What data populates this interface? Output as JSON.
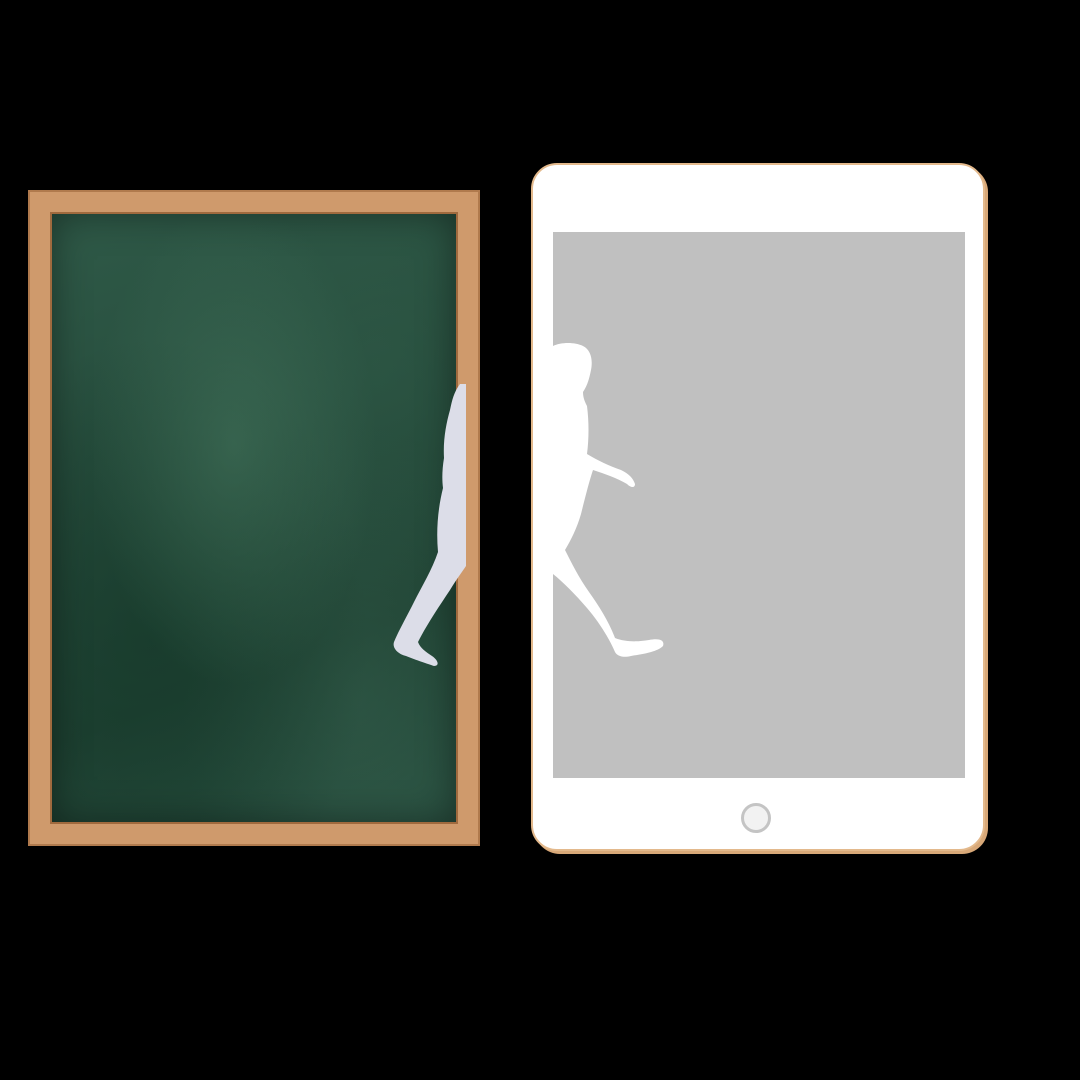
{
  "scene": {
    "background_color": "#000000",
    "chalkboard": {
      "frame_color": "#cf9a6c",
      "surface_color": "#264c3c"
    },
    "tablet": {
      "body_color": "#ffffff",
      "rim_color": "#e3b98c",
      "screen_color": "#c0c0c0",
      "home_button_icon": "home-button-icon"
    },
    "figures": {
      "walking_person_icon": "walking-person-silhouette-icon",
      "left_figure_color": "#dcdde8",
      "right_figure_color": "#ffffff"
    }
  }
}
